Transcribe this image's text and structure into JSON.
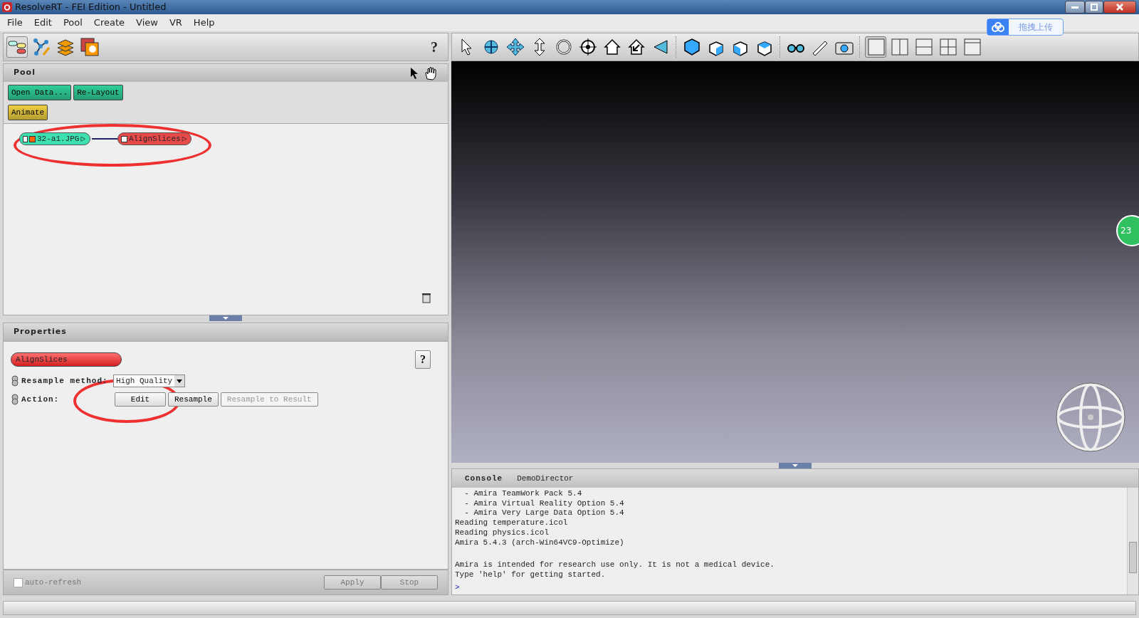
{
  "window": {
    "title": "ResolveRT - FEI Edition - Untitled"
  },
  "menu": [
    "File",
    "Edit",
    "Pool",
    "Create",
    "View",
    "VR",
    "Help"
  ],
  "left_toolbar": {
    "help": "?"
  },
  "pool": {
    "title": "Pool",
    "buttons": [
      {
        "label": "Open Data...",
        "color": "#2fcf9a"
      },
      {
        "label": "Re-Layout",
        "color": "#2fcf9a"
      },
      {
        "label": "Animate",
        "color": "#f0d040"
      }
    ],
    "nodes": [
      {
        "label": "32-a1.JPG",
        "color": "#3fe0b0",
        "port": "▷"
      },
      {
        "label": "AlignSlices",
        "color": "#e84a4a",
        "port": "▷"
      }
    ]
  },
  "properties": {
    "title": "Properties",
    "module": "AlignSlices",
    "help": "?",
    "params": [
      {
        "kind": "dropdown",
        "label": "Resample method:",
        "value": "High Quality"
      },
      {
        "kind": "buttons",
        "label": "Action:",
        "buttons": [
          {
            "label": "Edit",
            "disabled": false
          },
          {
            "label": "Resample",
            "disabled": false
          },
          {
            "label": "Resample to Result",
            "disabled": true
          }
        ]
      }
    ],
    "auto_refresh": {
      "label": "auto-refresh",
      "checked": false
    },
    "footer_buttons": [
      {
        "label": "Apply",
        "disabled": true
      },
      {
        "label": "Stop",
        "disabled": true
      }
    ]
  },
  "upload_badge": "拖拽上传",
  "side_badge": "23",
  "console": {
    "tabs": [
      {
        "label": "Console",
        "selected": true
      },
      {
        "label": "DemoDirector",
        "selected": false
      }
    ],
    "lines": [
      "  - Amira TeamWork Pack 5.4",
      "  - Amira Virtual Reality Option 5.4",
      "  - Amira Very Large Data Option 5.4",
      "Reading temperature.icol",
      "Reading physics.icol",
      "Amira 5.4.3 (arch-Win64VC9-Optimize)"
    ],
    "notice_lines": [
      "Amira is intended for research use only. It is not a medical device.",
      "Type 'help' for getting started."
    ],
    "prompt": ">"
  }
}
